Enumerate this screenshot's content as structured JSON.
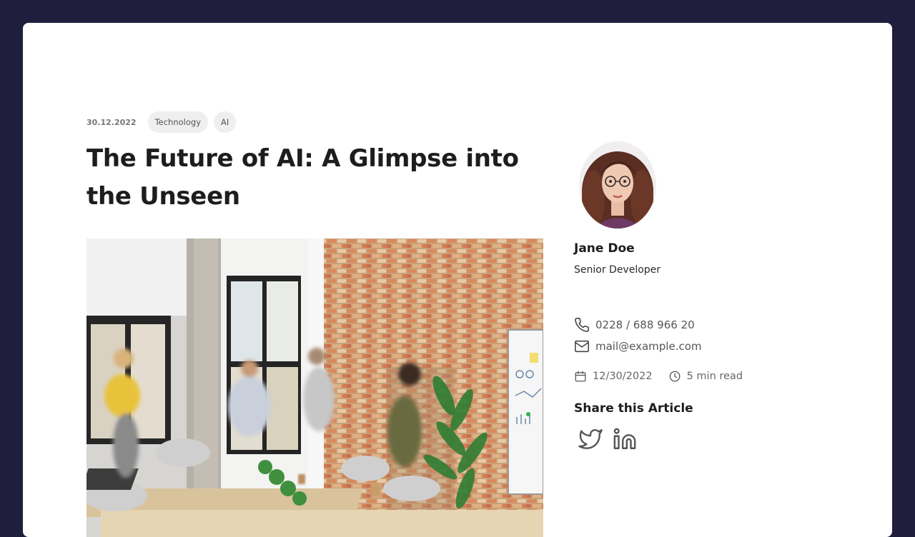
{
  "article": {
    "date": "30.12.2022",
    "tags": [
      "Technology",
      "AI"
    ],
    "title": "The Future of AI: A Glimpse into the Unseen",
    "hero_image": "office-team-meeting-photo"
  },
  "author": {
    "avatar": "woman-with-glasses-portrait",
    "name": "Jane Doe",
    "role": "Senior Developer",
    "phone": "0228 / 688 966 20",
    "email": "mail@example.com",
    "published": "12/30/2022",
    "read_time": "5 min read"
  },
  "share": {
    "title": "Share this Article",
    "icons": [
      "twitter-icon",
      "linkedin-icon"
    ]
  },
  "colors": {
    "background": "#1f1e3d",
    "card": "#ffffff",
    "tag_bg": "#efefef",
    "text": "#1d1d1d",
    "muted": "#666666"
  }
}
